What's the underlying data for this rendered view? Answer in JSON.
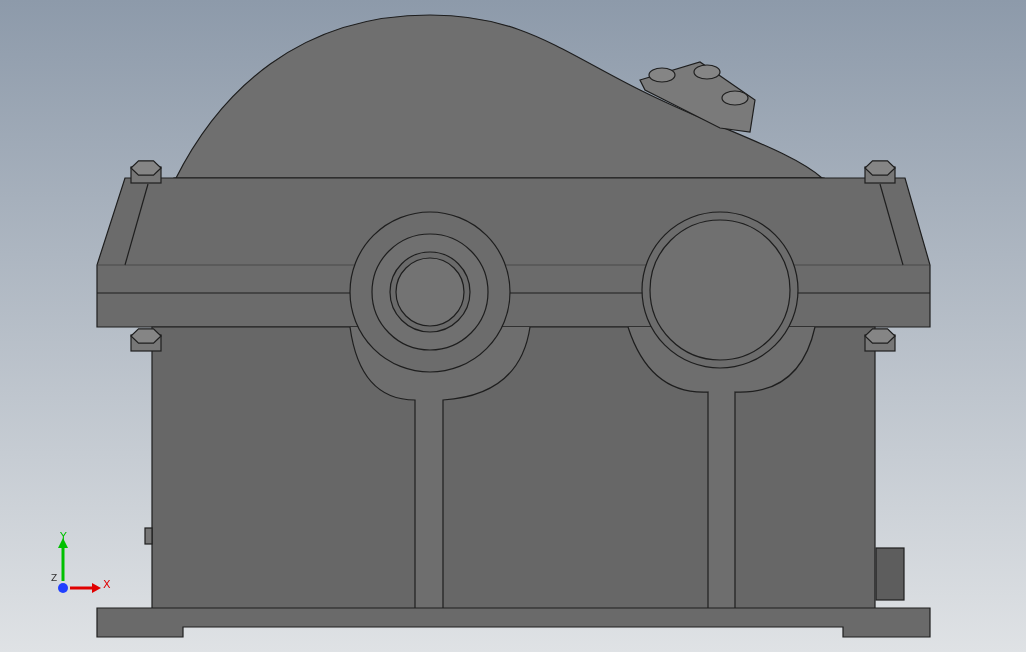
{
  "viewport": {
    "triad": {
      "axes": [
        {
          "label": "Y",
          "kind": "up",
          "color": "#00c000"
        },
        {
          "label": "X",
          "kind": "right",
          "color": "#e00000"
        },
        {
          "label": "Z",
          "kind": "out",
          "color": "#2040ff"
        }
      ]
    }
  }
}
